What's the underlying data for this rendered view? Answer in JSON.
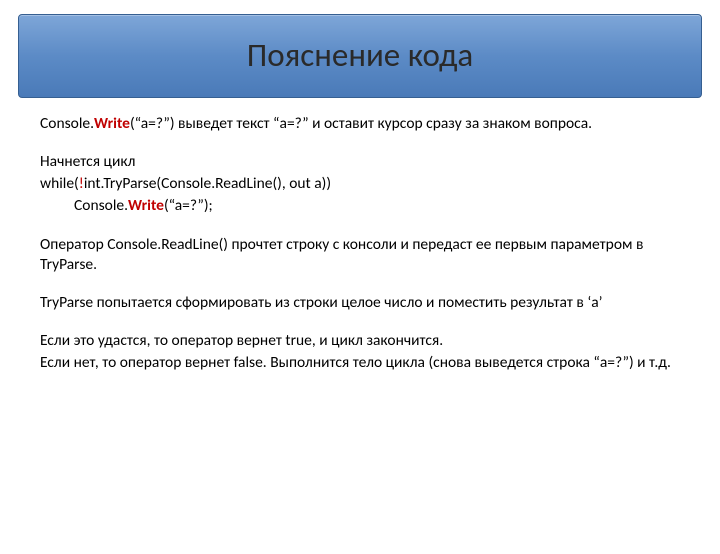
{
  "title": "Пояснение кода",
  "p1_a": "Console.",
  "p1_write": "Write",
  "p1_b": "(“a=?”) выведет текст “a=?” и оставит курсор сразу за знаком вопроса.",
  "p2": "Начнется цикл",
  "p3_a": "while(",
  "p3_bang": "!",
  "p3_b": "int.TryParse(Console.ReadLine(), out a))",
  "p4_a": "Console.",
  "p4_write": "Write",
  "p4_b": "(“a=?”);",
  "p5": "Оператор Console.ReadLine() прочтет строку с консоли и передаст ее первым параметром в TryParse.",
  "p6": "TryParse попытается сформировать из строки целое число и поместить результат в ‘a’",
  "p7": "Если это удастся, то оператор вернет true, и цикл закончится.",
  "p8": "Если нет, то оператор вернет false. Выполнится тело цикла (снова выведется строка “a=?”) и т.д."
}
